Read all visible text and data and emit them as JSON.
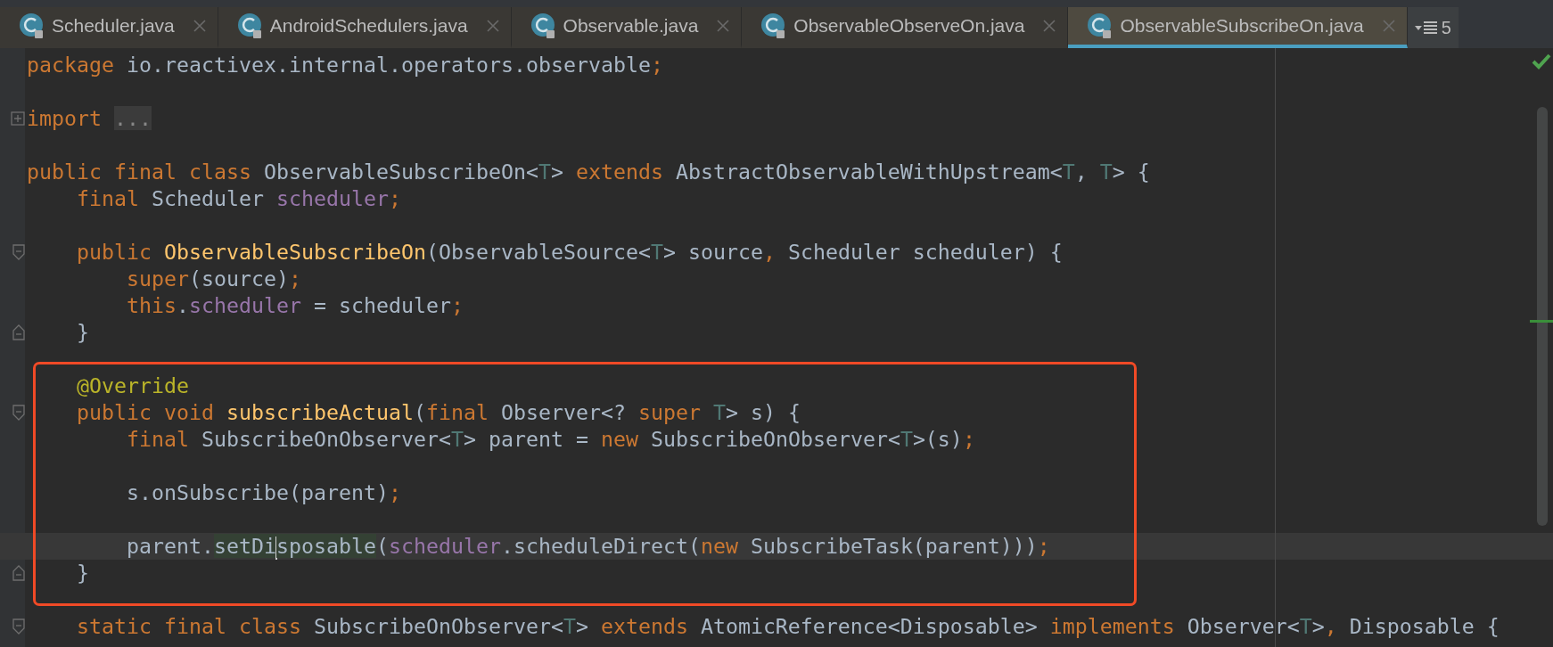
{
  "tabs": [
    {
      "label": "Scheduler.java",
      "selected": false
    },
    {
      "label": "AndroidSchedulers.java",
      "selected": false
    },
    {
      "label": "Observable.java",
      "selected": false
    },
    {
      "label": "ObservableObserveOn.java",
      "selected": false
    },
    {
      "label": "ObservableSubscribeOn.java",
      "selected": true
    }
  ],
  "tab_overflow": {
    "count": "5"
  },
  "code_blocks": [
    {
      "framed": false,
      "lines": [
        {
          "current": false,
          "segments": [
            {
              "text": "package",
              "kind": "keyword"
            },
            {
              "text": " io.reactivex.internal.operators.observable",
              "kind": "plain"
            },
            {
              "text": ";",
              "kind": "keyword"
            }
          ]
        },
        {
          "current": false
        },
        {
          "current": false,
          "fold_marker": {
            "kind": "collapsed"
          },
          "segments": [
            {
              "text": "import ",
              "kind": "keyword"
            },
            {
              "text": "...",
              "kind": "folded"
            }
          ]
        },
        {
          "current": false
        },
        {
          "current": false,
          "segments": [
            {
              "text": "public final class",
              "kind": "keyword"
            },
            {
              "text": " ObservableSubscribeOn<",
              "kind": "plain"
            },
            {
              "text": "T",
              "kind": "type_param"
            },
            {
              "text": "> ",
              "kind": "plain"
            },
            {
              "text": "extends",
              "kind": "keyword"
            },
            {
              "text": " AbstractObservableWithUpstream<",
              "kind": "plain"
            },
            {
              "text": "T",
              "kind": "type_param"
            },
            {
              "text": ", ",
              "kind": "plain"
            },
            {
              "text": "T",
              "kind": "type_param"
            },
            {
              "text": "> {",
              "kind": "plain"
            }
          ]
        },
        {
          "current": false,
          "segments": [
            {
              "text": "    final",
              "kind": "keyword"
            },
            {
              "text": " Scheduler ",
              "kind": "plain"
            },
            {
              "text": "scheduler",
              "kind": "field"
            },
            {
              "text": ";",
              "kind": "keyword"
            }
          ]
        },
        {
          "current": false
        },
        {
          "current": false,
          "fold_marker": {
            "kind": "start"
          },
          "segments": [
            {
              "text": "    public ",
              "kind": "keyword"
            },
            {
              "text": "ObservableSubscribeOn",
              "kind": "declaration"
            },
            {
              "text": "(ObservableSource<",
              "kind": "plain"
            },
            {
              "text": "T",
              "kind": "type_param"
            },
            {
              "text": "> source",
              "kind": "plain"
            },
            {
              "text": ",",
              "kind": "keyword"
            },
            {
              "text": " Scheduler scheduler) {",
              "kind": "plain"
            }
          ]
        },
        {
          "current": false,
          "segments": [
            {
              "text": "        super",
              "kind": "keyword"
            },
            {
              "text": "(source)",
              "kind": "plain"
            },
            {
              "text": ";",
              "kind": "keyword"
            }
          ]
        },
        {
          "current": false,
          "segments": [
            {
              "text": "        this",
              "kind": "keyword"
            },
            {
              "text": ".",
              "kind": "plain"
            },
            {
              "text": "scheduler",
              "kind": "field"
            },
            {
              "text": " = scheduler",
              "kind": "plain"
            },
            {
              "text": ";",
              "kind": "keyword"
            }
          ]
        },
        {
          "current": false,
          "fold_marker": {
            "kind": "end"
          },
          "segments": [
            {
              "text": "    }",
              "kind": "plain"
            }
          ]
        },
        {
          "current": false
        }
      ]
    },
    {
      "framed": true,
      "lines": [
        {
          "current": false,
          "segments": [
            {
              "text": "    @Override",
              "kind": "annotation"
            }
          ]
        },
        {
          "current": false,
          "fold_marker": {
            "kind": "start"
          },
          "segments": [
            {
              "text": "    public void ",
              "kind": "keyword"
            },
            {
              "text": "subscribeActual",
              "kind": "declaration"
            },
            {
              "text": "(",
              "kind": "plain"
            },
            {
              "text": "final",
              "kind": "keyword"
            },
            {
              "text": " Observer<? ",
              "kind": "plain"
            },
            {
              "text": "super ",
              "kind": "keyword"
            },
            {
              "text": "T",
              "kind": "type_param"
            },
            {
              "text": "> s) {",
              "kind": "plain"
            }
          ]
        },
        {
          "current": false,
          "segments": [
            {
              "text": "        final",
              "kind": "keyword"
            },
            {
              "text": " SubscribeOnObserver<",
              "kind": "plain"
            },
            {
              "text": "T",
              "kind": "type_param"
            },
            {
              "text": "> parent = ",
              "kind": "plain"
            },
            {
              "text": "new",
              "kind": "keyword"
            },
            {
              "text": " SubscribeOnObserver<",
              "kind": "plain"
            },
            {
              "text": "T",
              "kind": "type_param"
            },
            {
              "text": ">(s)",
              "kind": "plain"
            },
            {
              "text": ";",
              "kind": "keyword"
            }
          ]
        },
        {
          "current": false
        },
        {
          "current": false,
          "segments": [
            {
              "text": "        s.onSubscribe(parent)",
              "kind": "plain"
            },
            {
              "text": ";",
              "kind": "keyword"
            }
          ]
        },
        {
          "current": false
        },
        {
          "current": true,
          "segments": [
            {
              "text": "        parent.",
              "kind": "plain"
            },
            {
              "text": "setDi",
              "kind": "usage",
              "caret_after": true
            },
            {
              "text": "sposable",
              "kind": "usage",
              "caret_after": false
            },
            {
              "text": "(",
              "kind": "plain"
            },
            {
              "text": "scheduler",
              "kind": "field"
            },
            {
              "text": ".scheduleDirect(",
              "kind": "plain"
            },
            {
              "text": "new",
              "kind": "keyword"
            },
            {
              "text": " SubscribeTask(parent)))",
              "kind": "plain"
            },
            {
              "text": ";",
              "kind": "keyword"
            }
          ]
        },
        {
          "current": false,
          "fold_marker": {
            "kind": "end"
          },
          "segments": [
            {
              "text": "    }",
              "kind": "plain"
            }
          ]
        },
        {
          "current": false
        }
      ]
    },
    {
      "framed": false,
      "lines": [
        {
          "current": false,
          "fold_marker": {
            "kind": "start"
          },
          "segments": [
            {
              "text": "    static final class",
              "kind": "keyword"
            },
            {
              "text": " SubscribeOnObserver<",
              "kind": "plain"
            },
            {
              "text": "T",
              "kind": "type_param"
            },
            {
              "text": "> ",
              "kind": "plain"
            },
            {
              "text": "extends",
              "kind": "keyword"
            },
            {
              "text": " AtomicReference<Disposable> ",
              "kind": "plain"
            },
            {
              "text": "implements",
              "kind": "keyword"
            },
            {
              "text": " Observer<",
              "kind": "plain"
            },
            {
              "text": "T",
              "kind": "type_param"
            },
            {
              "text": ">",
              "kind": "plain"
            },
            {
              "text": ",",
              "kind": "keyword"
            },
            {
              "text": " Disposable {",
              "kind": "plain"
            }
          ]
        }
      ]
    }
  ]
}
